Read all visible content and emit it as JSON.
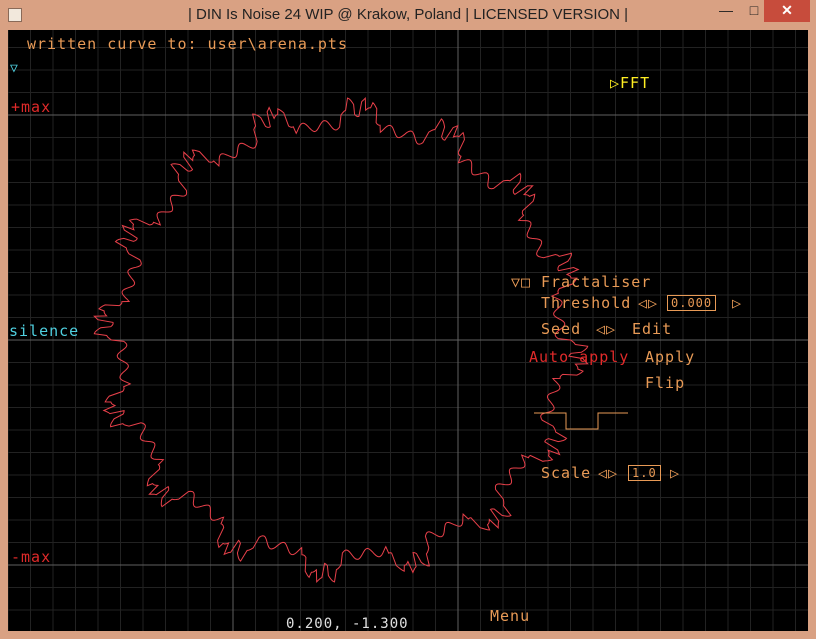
{
  "window": {
    "title": "| DIN Is Noise 24 WIP @ Krakow, Poland | LICENSED VERSION |",
    "minimize_glyph": "—",
    "maximize_glyph": "□",
    "close_glyph": "✕"
  },
  "status_message": "written curve to: user\\arena.pts",
  "labels": {
    "plus_max": "+max",
    "silence": "silence",
    "minus_max": "-max",
    "collapse_glyph": "▽"
  },
  "fft": {
    "arrow": "▷",
    "label": "FFT"
  },
  "fractaliser": {
    "toggle": "▽□",
    "title": "Fractaliser",
    "threshold_label": "Threshold",
    "threshold_arrows": "◁▷",
    "threshold_value": "0.000",
    "threshold_right_arrow": "▷",
    "seed_label": "Seed",
    "seed_arrows": "◁▷",
    "edit_label": "Edit",
    "auto_apply_label": "Auto apply",
    "apply_label": "Apply",
    "flip_label": "Flip",
    "scale_label": "Scale",
    "scale_arrows": "◁▷",
    "scale_value": "1.0",
    "scale_right_arrow": "▷"
  },
  "menu_label": "Menu",
  "cursor_readout": "0.200, -1.300",
  "colors": {
    "background": "#000000",
    "grid": "#222222",
    "axis": "#606060",
    "curve": "#e8404a",
    "level_label": "#e02a2a",
    "silence_label": "#4fd0e0",
    "orange_text": "#e89a56",
    "fft_text": "#ffee22"
  }
}
